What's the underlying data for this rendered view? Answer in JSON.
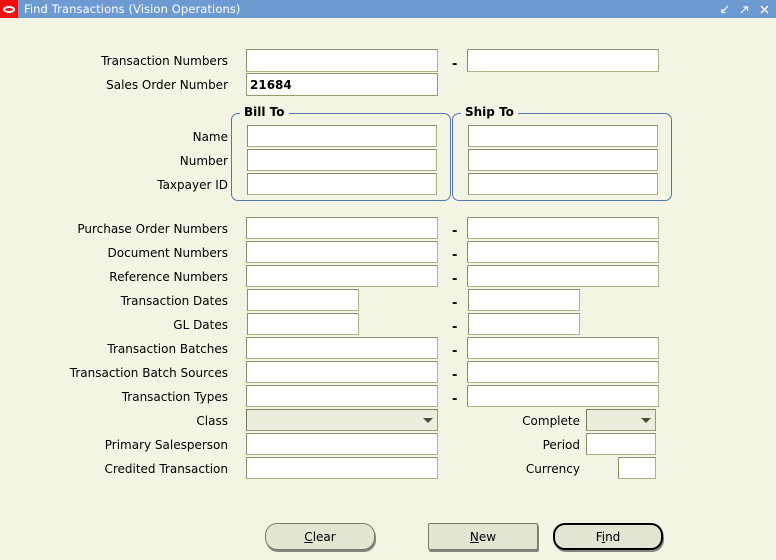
{
  "window": {
    "title": "Find Transactions (Vision Operations)",
    "logo_icon": "oracle-logo-icon",
    "controls": [
      {
        "name": "minimize-button",
        "icon": "arrow-down-left-icon"
      },
      {
        "name": "maximize-button",
        "icon": "arrow-up-right-icon"
      },
      {
        "name": "close-button",
        "icon": "close-x-icon"
      }
    ],
    "titlebar_color": "#6d9bd1",
    "background_color": "#f3f4e4"
  },
  "form": {
    "top_fields": [
      {
        "label": "Transaction Numbers",
        "value": "",
        "to_value": "",
        "has_range": true
      },
      {
        "label": "Sales Order Number",
        "value": "21684",
        "has_range": false,
        "focused": true
      }
    ],
    "groups": [
      {
        "title": "Bill To",
        "fields": [
          {
            "label": "Name",
            "value": ""
          },
          {
            "label": "Number",
            "value": ""
          },
          {
            "label": "Taxpayer ID",
            "value": ""
          }
        ]
      },
      {
        "title": "Ship To",
        "fields": [
          {
            "value": ""
          },
          {
            "value": ""
          },
          {
            "value": ""
          }
        ]
      }
    ],
    "range_fields": [
      {
        "label": "Purchase Order Numbers",
        "from": "",
        "to": "",
        "width": "wide"
      },
      {
        "label": "Document Numbers",
        "from": "",
        "to": "",
        "width": "wide"
      },
      {
        "label": "Reference Numbers",
        "from": "",
        "to": "",
        "width": "wide"
      },
      {
        "label": "Transaction Dates",
        "from": "",
        "to": "",
        "width": "narrow"
      },
      {
        "label": "GL Dates",
        "from": "",
        "to": "",
        "width": "narrow"
      },
      {
        "label": "Transaction Batches",
        "from": "",
        "to": "",
        "width": "wide"
      },
      {
        "label": "Transaction Batch Sources",
        "from": "",
        "to": "",
        "width": "wide"
      },
      {
        "label": "Transaction Types",
        "from": "",
        "to": "",
        "width": "wide"
      }
    ],
    "left_fields": [
      {
        "label": "Class",
        "value": "",
        "type": "combo"
      },
      {
        "label": "Primary Salesperson",
        "value": "",
        "type": "text"
      },
      {
        "label": "Credited Transaction",
        "value": "",
        "type": "text"
      }
    ],
    "right_fields": [
      {
        "label": "Complete",
        "value": "",
        "type": "combo"
      },
      {
        "label": "Period",
        "value": "",
        "type": "text"
      },
      {
        "label": "Currency",
        "value": "",
        "type": "text"
      }
    ],
    "range_separator": "-"
  },
  "buttons": [
    {
      "name": "clear-button",
      "pre": "",
      "mnemonic": "C",
      "post": "lear",
      "style": "rounded"
    },
    {
      "name": "new-button",
      "pre": "",
      "mnemonic": "N",
      "post": "ew",
      "style": "square"
    },
    {
      "name": "find-button",
      "pre": "F",
      "mnemonic": "i",
      "post": "nd",
      "style": "default"
    }
  ]
}
